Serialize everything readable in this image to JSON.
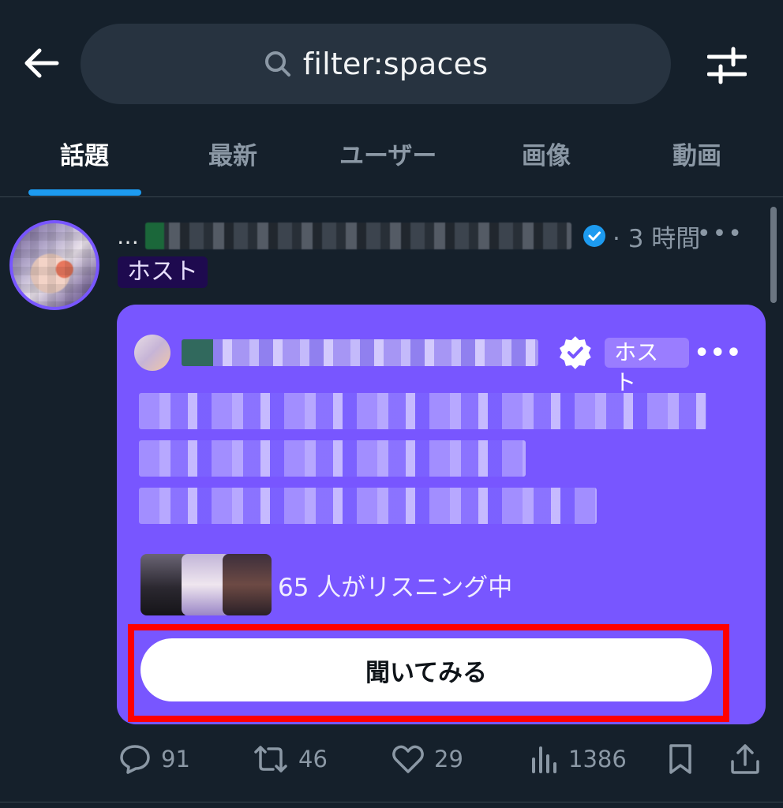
{
  "search": {
    "query": "filter:spaces"
  },
  "tabs": [
    {
      "label": "話題",
      "active": true
    },
    {
      "label": "最新",
      "active": false
    },
    {
      "label": "ユーザー",
      "active": false
    },
    {
      "label": "画像",
      "active": false
    },
    {
      "label": "動画",
      "active": false
    }
  ],
  "post": {
    "name_prefix": "…",
    "time": "· 3 時間",
    "more": "•••",
    "host_badge": "ホスト",
    "card": {
      "host_badge": "ホスト",
      "more": "•••",
      "listeners": "65 人がリスニング中",
      "listen_button": "聞いてみる"
    },
    "actions": {
      "replies": "91",
      "reposts": "46",
      "likes": "29",
      "views": "1386"
    }
  },
  "colors": {
    "background": "#15202b",
    "accent": "#1d9bf0",
    "space_card": "#7856ff",
    "highlight_outline": "#ff0000"
  }
}
